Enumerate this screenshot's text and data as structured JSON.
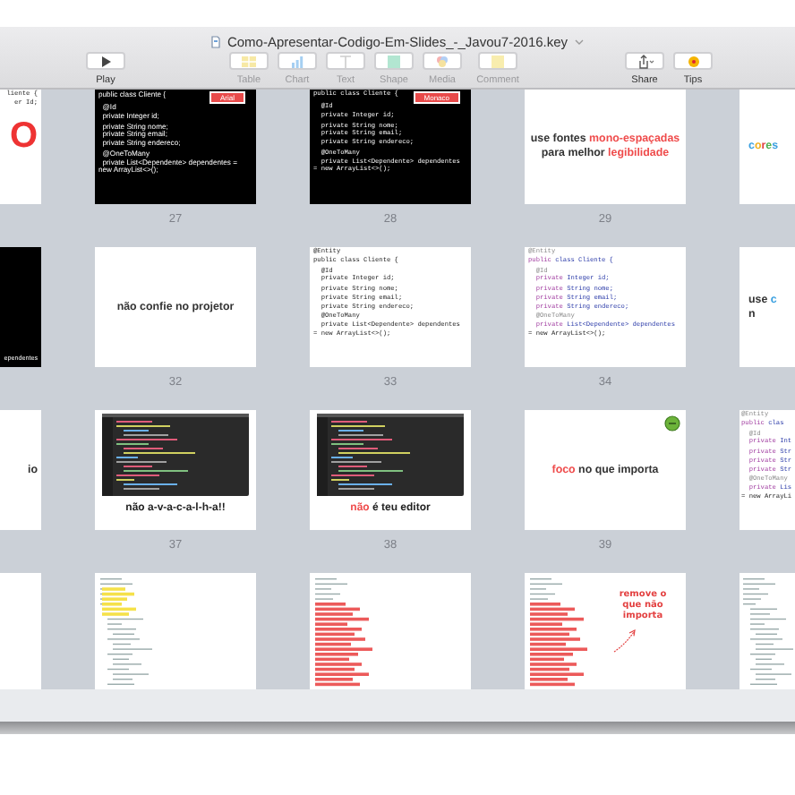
{
  "window": {
    "title": "Como-Apresentar-Codigo-Em-Slides_-_Javou7-2016.key"
  },
  "toolbar": [
    {
      "label": "Play",
      "disabled": false
    },
    {
      "label": "Table",
      "disabled": true
    },
    {
      "label": "Chart",
      "disabled": true
    },
    {
      "label": "Text",
      "disabled": true
    },
    {
      "label": "Shape",
      "disabled": true
    },
    {
      "label": "Media",
      "disabled": true
    },
    {
      "label": "Comment",
      "disabled": true
    },
    {
      "label": "Share",
      "disabled": false
    },
    {
      "label": "Tips",
      "disabled": false
    }
  ],
  "rows": [
    {
      "slides": [
        {
          "kind": "code-light",
          "blocks": [
            [
              "liente {",
              "er Id;"
            ]
          ],
          "big_text": "O"
        },
        {
          "kind": "code-dark",
          "number": "27",
          "tag": "Arial",
          "mono": false,
          "blocks": [
            [
              "public class Cliente {"
            ],
            [
              "  @Id",
              "  private Integer id;"
            ],
            [
              "  private String nome;",
              "  private String email;",
              "  private String endereco;"
            ],
            [
              "  @OneToMany",
              "  private List<Dependente> dependentes =",
              "new ArrayList<>();"
            ]
          ]
        },
        {
          "kind": "code-dark",
          "number": "28",
          "tag": "Monaco",
          "mono": true,
          "blocks": [
            [
              "public class Cliente {"
            ],
            [
              "  @Id",
              "  private Integer id;"
            ],
            [
              "  private String nome;",
              "  private String email;",
              "  private String endereco;"
            ],
            [
              "  @OneToMany",
              "  private List<Dependente> dependentes",
              "= new ArrayList<>();"
            ]
          ]
        },
        {
          "kind": "statement",
          "number": "29",
          "parts": [
            [
              {
                "text": "use fontes "
              },
              {
                "text": "mono-espaçadas",
                "color": "#ef4b4b"
              }
            ],
            [
              {
                "text": "para melhor "
              },
              {
                "text": "legibilidade",
                "color": "#ef4b4b"
              }
            ]
          ]
        },
        {
          "kind": "statement",
          "parts": [
            [
              {
                "text": "c",
                "color": "#3aa0e0"
              },
              {
                "text": "o",
                "color": "#f0b020"
              },
              {
                "text": "r",
                "color": "#e04040"
              },
              {
                "text": "e",
                "color": "#50b050"
              },
              {
                "text": "s",
                "color": "#3aa0e0"
              }
            ]
          ]
        }
      ]
    },
    {
      "slides": [
        {
          "kind": "caption-dark",
          "blocks": [
            [
              "ependentes"
            ]
          ]
        },
        {
          "kind": "statement",
          "number": "32",
          "parts": [
            [
              {
                "text": "não confie no projetor"
              }
            ]
          ]
        },
        {
          "kind": "code-light",
          "number": "33",
          "colored": false,
          "blocks": [
            [
              "@Entity",
              "public class Cliente {"
            ],
            [
              "  @Id",
              "  private Integer id;"
            ],
            [
              "  private String nome;",
              "  private String email;",
              "  private String endereco;"
            ],
            [
              "  @OneToMany",
              "  private List<Dependente> dependentes",
              "= new ArrayList<>();"
            ]
          ]
        },
        {
          "kind": "code-light",
          "number": "34",
          "colored": true,
          "blocks": [
            [
              "@Entity",
              "public class Cliente {"
            ],
            [
              "  @Id",
              "  private Integer id;"
            ],
            [
              "  private String nome;",
              "  private String email;",
              "  private String endereco;"
            ],
            [
              "  @OneToMany",
              "  private List<Dependente> dependentes",
              "= new ArrayList<>();"
            ]
          ]
        },
        {
          "kind": "statement",
          "parts": [
            [
              {
                "text": "use "
              },
              {
                "text": "c",
                "color": "#3aa0e0"
              }
            ],
            [
              {
                "text": "n"
              }
            ]
          ]
        }
      ]
    },
    {
      "slides": [
        {
          "kind": "statement",
          "parts": [
            [
              {
                "text": "io"
              }
            ]
          ]
        },
        {
          "kind": "editor-shot",
          "number": "37",
          "parts": [
            {
              "text": "não a-v-a-c-a-l-h-a!!"
            }
          ]
        },
        {
          "kind": "editor-shot",
          "number": "38",
          "parts": [
            {
              "text": "não",
              "color": "#ef4b4b"
            },
            {
              "text": " é teu editor"
            }
          ]
        },
        {
          "kind": "statement",
          "number": "39",
          "sticker": true,
          "parts": [
            [
              {
                "text": "foco",
                "color": "#ef4b4b"
              },
              {
                "text": " no que importa"
              }
            ]
          ]
        },
        {
          "kind": "code-light",
          "colored": true,
          "blocks": [
            [
              "@Entity",
              "public clas"
            ],
            [
              "  @Id",
              "  private Int"
            ],
            [
              "  private Str",
              "  private Str",
              "  private Str"
            ],
            [
              "  @OneToMany",
              "  private Lis",
              "= new ArrayLi"
            ]
          ]
        }
      ]
    },
    {
      "slides": [
        {
          "kind": "blank"
        },
        {
          "kind": "sketch",
          "color": "#f5e14a"
        },
        {
          "kind": "sketch",
          "color": "#ec5a5a"
        },
        {
          "kind": "sketch",
          "color": "#ec5a5a",
          "note": "remove o que não importa"
        },
        {
          "kind": "sketch"
        }
      ]
    }
  ]
}
